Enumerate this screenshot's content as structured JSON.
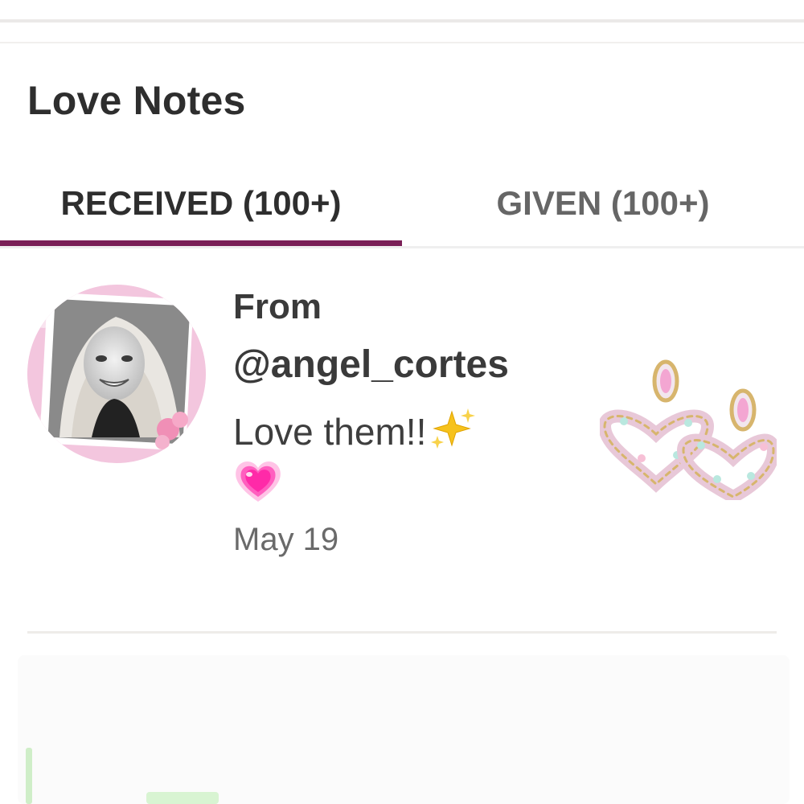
{
  "section": {
    "title": "Love Notes"
  },
  "tabs": [
    {
      "label": "RECEIVED (100+)",
      "selected": true
    },
    {
      "label": "GIVEN (100+)",
      "selected": false
    }
  ],
  "colors": {
    "accent": "#7a1f57",
    "tab_inactive": "#666666",
    "text": "#2e2e2e"
  },
  "note": {
    "avatar_icon": "user-avatar",
    "from_label": "From",
    "handle": "@angel_cortes",
    "message": "Love them!!",
    "emojis": [
      "sparkles-icon",
      "growing-heart-icon"
    ],
    "date": "May 19",
    "product_icon": "heart-earrings-image"
  }
}
